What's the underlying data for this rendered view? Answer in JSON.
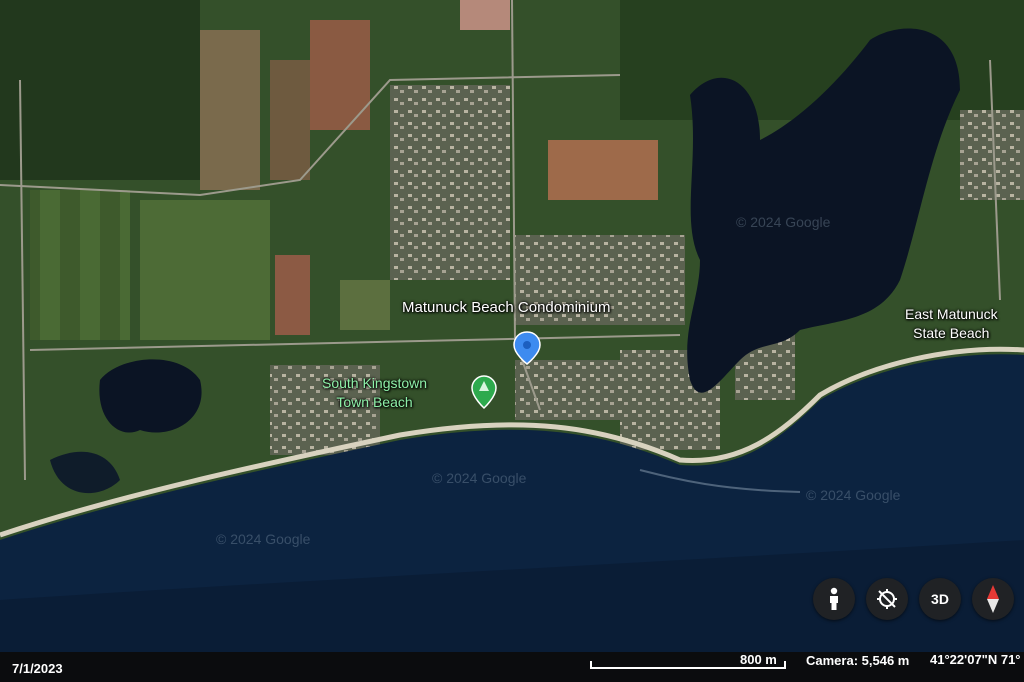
{
  "map": {
    "labels": {
      "condominium": "Matunuck Beach Condominium",
      "east_beach_line1": "East Matunuck",
      "east_beach_line2": "State Beach",
      "town_beach_line1": "South Kingstown",
      "town_beach_line2": "Town Beach"
    },
    "watermark": "© 2024 Google",
    "imagery": "satellite",
    "colors": {
      "ocean": "#0c2340",
      "land": "#36502a",
      "pin_blue": "#3d8bf0",
      "pin_green": "#2eaa4e"
    }
  },
  "controls": {
    "pegman_icon": "street-view-person-icon",
    "nav_icon": "navigation-off-icon",
    "three_d": "3D",
    "compass_icon": "compass-icon"
  },
  "status": {
    "date": "7/1/2023",
    "scale": "800 m",
    "camera": "Camera: 5,546 m",
    "coords": "41°22'07\"N 71°"
  }
}
